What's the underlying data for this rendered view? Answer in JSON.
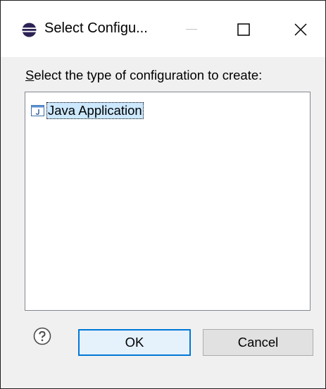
{
  "window": {
    "title": "Select Configu..."
  },
  "titlebar_buttons": {
    "minimize_icon": "minimize-icon",
    "maximize_icon": "maximize-icon",
    "close_icon": "close-icon"
  },
  "dialog": {
    "prompt_mnemonic": "S",
    "prompt_rest": "elect the type of configuration to create:",
    "list_items": [
      {
        "label": "Java Application",
        "icon": "java-application-icon",
        "selected": true
      }
    ]
  },
  "buttons": {
    "ok_label": "OK",
    "cancel_label": "Cancel",
    "help_icon": "help-icon"
  },
  "colors": {
    "accent": "#0078d7",
    "selection": "#cce8ff",
    "dialog_bg": "#f0f0f0"
  }
}
